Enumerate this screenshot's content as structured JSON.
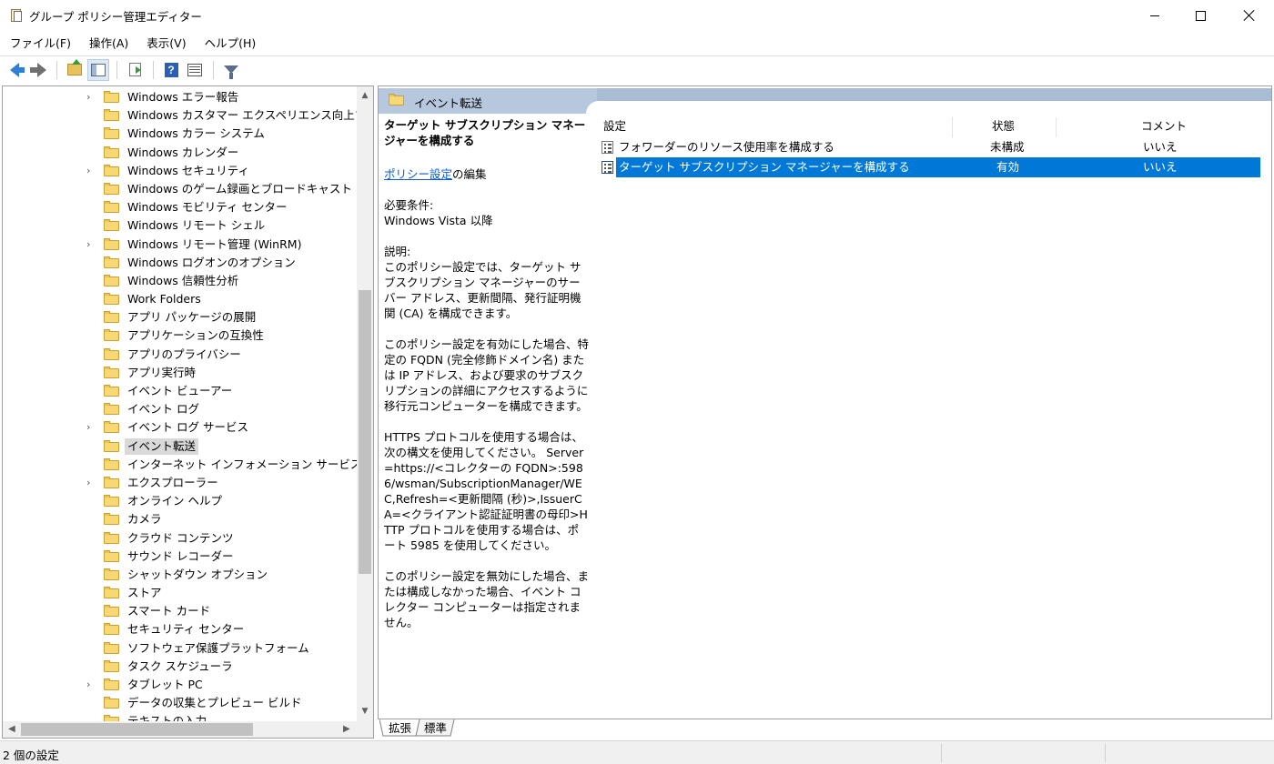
{
  "window": {
    "title": "グループ ポリシー管理エディター"
  },
  "menu": [
    "ファイル(F)",
    "操作(A)",
    "表示(V)",
    "ヘルプ(H)"
  ],
  "toolbar": {
    "icons": [
      "back-arrow-icon",
      "forward-arrow-icon",
      "up-folder-icon",
      "show-tree-icon",
      "export-list-icon",
      "help-icon",
      "properties-icon",
      "filter-icon"
    ]
  },
  "tree": {
    "items": [
      {
        "label": "Windows エラー報告",
        "expandable": true
      },
      {
        "label": "Windows カスタマー エクスペリエンス向上プログラ",
        "expandable": false
      },
      {
        "label": "Windows カラー システム",
        "expandable": false
      },
      {
        "label": "Windows カレンダー",
        "expandable": false
      },
      {
        "label": "Windows セキュリティ",
        "expandable": true
      },
      {
        "label": "Windows のゲーム録画とブロードキャスト",
        "expandable": false
      },
      {
        "label": "Windows モビリティ センター",
        "expandable": false
      },
      {
        "label": "Windows リモート シェル",
        "expandable": false
      },
      {
        "label": "Windows リモート管理 (WinRM)",
        "expandable": true
      },
      {
        "label": "Windows ログオンのオプション",
        "expandable": false
      },
      {
        "label": "Windows 信頼性分析",
        "expandable": false
      },
      {
        "label": "Work Folders",
        "expandable": false
      },
      {
        "label": "アプリ パッケージの展開",
        "expandable": false
      },
      {
        "label": "アプリケーションの互換性",
        "expandable": false
      },
      {
        "label": "アプリのプライバシー",
        "expandable": false
      },
      {
        "label": "アプリ実行時",
        "expandable": false
      },
      {
        "label": "イベント ビューアー",
        "expandable": false
      },
      {
        "label": "イベント ログ",
        "expandable": false
      },
      {
        "label": "イベント ログ サービス",
        "expandable": true
      },
      {
        "label": "イベント転送",
        "expandable": false,
        "selected": true
      },
      {
        "label": "インターネット インフォメーション サービス",
        "expandable": false
      },
      {
        "label": "エクスプローラー",
        "expandable": true
      },
      {
        "label": "オンライン ヘルプ",
        "expandable": false
      },
      {
        "label": "カメラ",
        "expandable": false
      },
      {
        "label": "クラウド コンテンツ",
        "expandable": false
      },
      {
        "label": "サウンド レコーダー",
        "expandable": false
      },
      {
        "label": "シャットダウン オプション",
        "expandable": false
      },
      {
        "label": "ストア",
        "expandable": false
      },
      {
        "label": "スマート カード",
        "expandable": false
      },
      {
        "label": "セキュリティ センター",
        "expandable": false
      },
      {
        "label": "ソフトウェア保護プラットフォーム",
        "expandable": false
      },
      {
        "label": "タスク スケジューラ",
        "expandable": false
      },
      {
        "label": "タブレット PC",
        "expandable": true
      },
      {
        "label": "データの収集とプレビュー ビルド",
        "expandable": false
      },
      {
        "label": "テキストの入力",
        "expandable": false
      }
    ]
  },
  "right_pane": {
    "header_title": "イベント転送",
    "description": {
      "policy_title": "ターゲット サブスクリプション マネージャーを構成する",
      "edit_link": "ポリシー設定",
      "edit_suffix": "の編集",
      "requirements_label": "必要条件:",
      "requirements_value": "Windows Vista 以降",
      "explanation_label": "説明:",
      "paragraph1": "このポリシー設定では、ターゲット サブスクリプション マネージャーのサーバー アドレス、更新間隔、発行証明機関 (CA) を構成できます。",
      "paragraph2": "このポリシー設定を有効にした場合、特定の FQDN (完全修飾ドメイン名) または IP アドレス、および要求のサブスクリプションの詳細にアクセスするように移行元コンピューターを構成できます。",
      "paragraph3": "HTTPS プロトコルを使用する場合は、次の構文を使用してください。 Server=https://<コレクターの FQDN>:5986/wsman/SubscriptionManager/WEC,Refresh=<更新間隔 (秒)>,IssuerCA=<クライアント認証証明書の母印>HTTP プロトコルを使用する場合は、ポート 5985 を使用してください。",
      "paragraph4": "このポリシー設定を無効にした場合、または構成しなかった場合、イベント コレクター コンピューターは指定されません。"
    },
    "table": {
      "columns": {
        "setting": "設定",
        "state": "状態",
        "comment": "コメント"
      },
      "rows": [
        {
          "setting": "フォワーダーのリソース使用率を構成する",
          "state": "未構成",
          "comment": "いいえ",
          "selected": false
        },
        {
          "setting": "ターゲット サブスクリプション マネージャーを構成する",
          "state": "有効",
          "comment": "いいえ",
          "selected": true
        }
      ]
    }
  },
  "bottom_tabs": [
    "拡張",
    "標準"
  ],
  "status": {
    "text": "2 個の設定"
  },
  "colors": {
    "selection": "#0078d7",
    "header": "#a9bcd6",
    "link": "#0a5bd0"
  }
}
